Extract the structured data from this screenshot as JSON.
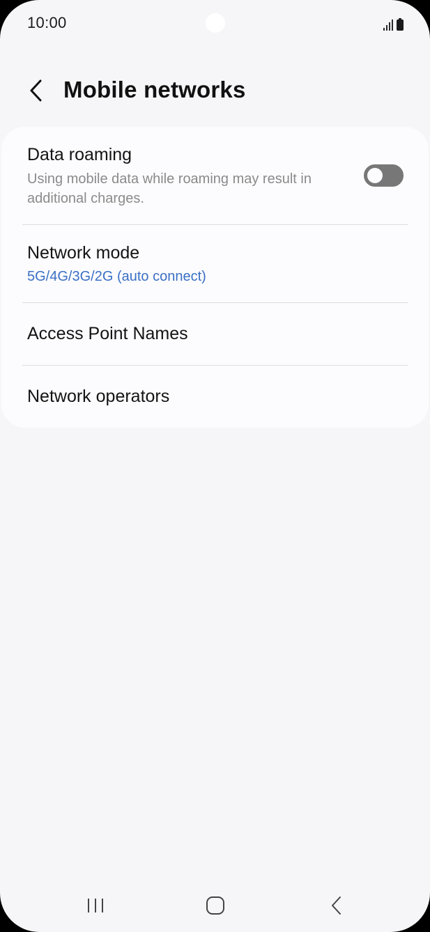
{
  "status_bar": {
    "time": "10:00",
    "icons": [
      "signal-icon",
      "battery-icon"
    ]
  },
  "header": {
    "title": "Mobile networks",
    "back_icon": "chevron-left-icon"
  },
  "settings": {
    "data_roaming": {
      "title": "Data roaming",
      "description": "Using mobile data while roaming may result in additional charges.",
      "enabled": false
    },
    "network_mode": {
      "title": "Network mode",
      "value": "5G/4G/3G/2G (auto connect)"
    },
    "access_point_names": {
      "title": "Access Point Names"
    },
    "network_operators": {
      "title": "Network operators"
    }
  },
  "navigation": {
    "buttons": [
      "recent-apps-icon",
      "home-icon",
      "back-icon"
    ]
  },
  "colors": {
    "background": "#f6f6f8",
    "card": "#fcfcfe",
    "accent": "#3a6fc4",
    "toggle_off": "#777777"
  }
}
